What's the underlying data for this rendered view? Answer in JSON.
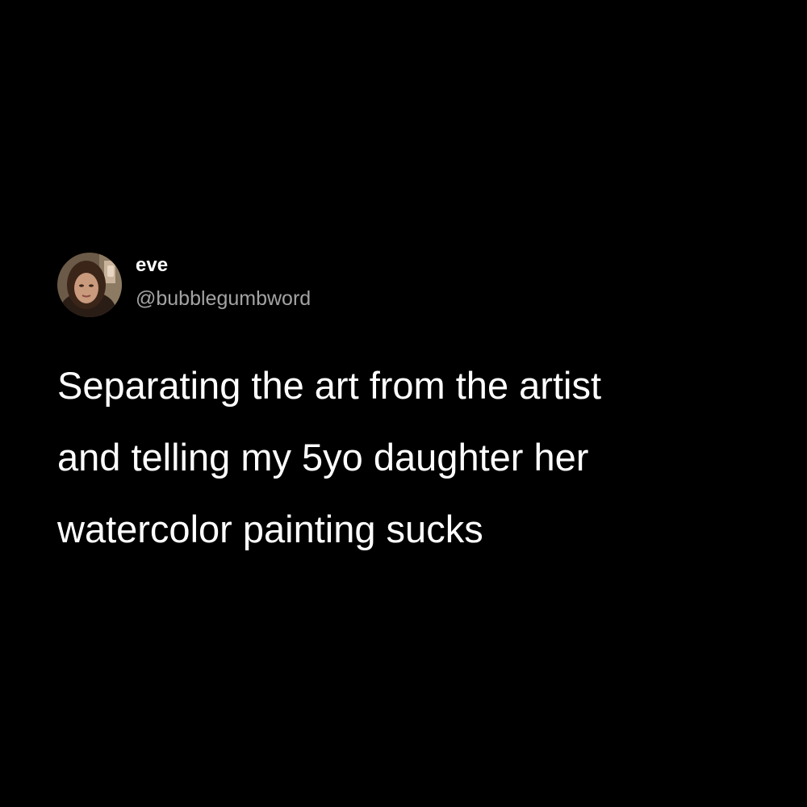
{
  "tweet": {
    "author": {
      "display_name": "eve",
      "handle": "@bubblegumbword",
      "avatar": "profile-photo"
    },
    "text_lines": [
      "Separating the art from the artist",
      "and telling my 5yo daughter her",
      "watercolor painting sucks"
    ]
  },
  "colors": {
    "background": "#000000",
    "text": "#ffffff",
    "handle": "#a3a3a3"
  }
}
